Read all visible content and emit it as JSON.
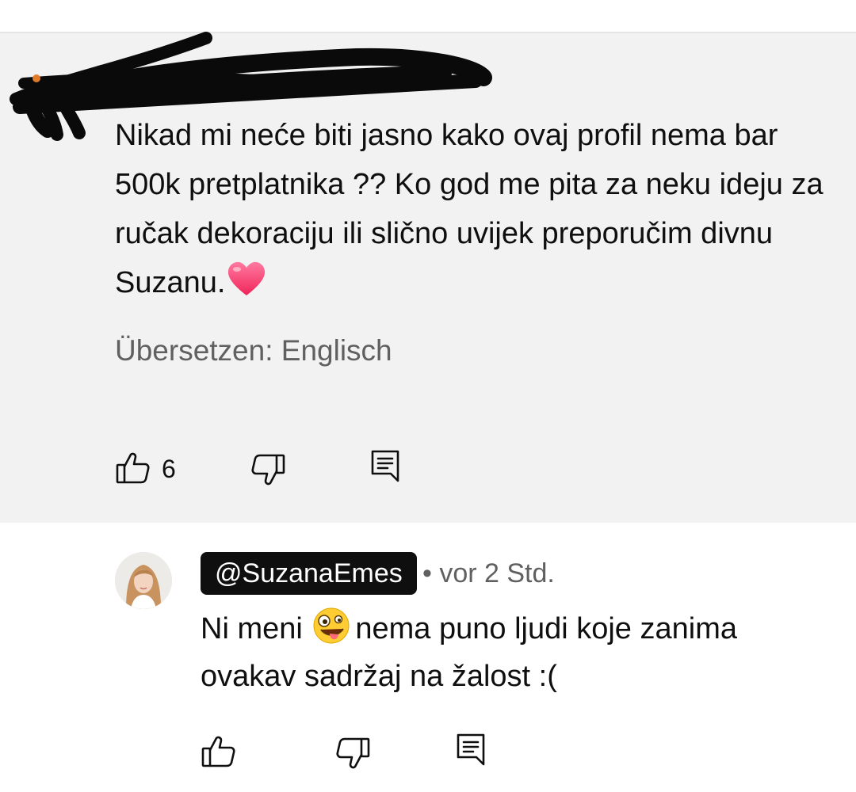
{
  "comment": {
    "text": "Nikad mi neće biti jasno kako ovaj profil nema bar 500k pretplatnika ?? Ko god me pita za neku ideju za ručak dekoraciju ili slično uvijek preporučim divnu Suzanu.",
    "emoji": "heart",
    "translate_label": "Übersetzen: Englisch",
    "like_count": "6",
    "icons": {
      "like": "thumb-up-icon",
      "dislike": "thumb-down-icon",
      "reply": "reply-comment-icon"
    }
  },
  "reply": {
    "author_handle": "@SuzanaEmes",
    "meta": "• vor 2 Std.",
    "text_before_emoji": "Ni meni",
    "emoji": "zany-face",
    "text_after_emoji": "nema puno ljudi koje zanima ovakav sadržaj na žalost :(",
    "icons": {
      "like": "thumb-up-icon",
      "dislike": "thumb-down-icon",
      "reply": "reply-comment-icon"
    }
  },
  "colors": {
    "highlight_background": "#f2f2f2",
    "primary_text": "#0f0f0f",
    "secondary_text": "#606060",
    "handle_badge": "#0f0f0f",
    "heart": "#ff3b6b"
  }
}
